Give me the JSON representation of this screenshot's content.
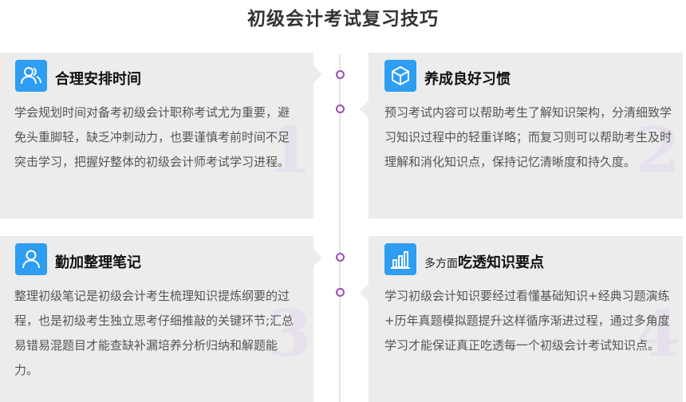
{
  "page_title": "初级会计考试复习技巧",
  "cards": [
    {
      "icon": "users-icon",
      "heading": "合理安排时间",
      "text": "学会规划时间对备考初级会计职称考试尤为重要，避免头重脚轻，缺乏冲刺动力，也要谨慎考前时间不足突击学习，把握好整体的初级会计师考试学习进程。",
      "number": "1"
    },
    {
      "icon": "cube-icon",
      "heading": "养成良好习惯",
      "text": "预习考试内容可以帮助考生了解知识架构，分清细致学习知识过程中的轻重详略；而复习则可以帮助考生及时理解和消化知识点，保持记忆清晰度和持久度。",
      "number": "2"
    },
    {
      "icon": "user-icon",
      "heading": "勤加整理笔记",
      "text": "整理初级笔记是初级会计考生梳理知识提炼纲要的过程，也是初级考生独立思考仔细推敲的关键环节;汇总易错易混题目才能查缺补漏培养分析归纳和解题能力。",
      "number": "3"
    },
    {
      "icon": "bar-chart-icon",
      "heading_prefix": "多方面",
      "heading": "吃透知识要点",
      "text": "学习初级会计知识要经过看懂基础知识+经典习题演练+历年真题模拟题提升这样循序渐进过程，通过多角度学习才能保证真正吃透每一个初级会计考试知识点。",
      "number": "4"
    }
  ]
}
